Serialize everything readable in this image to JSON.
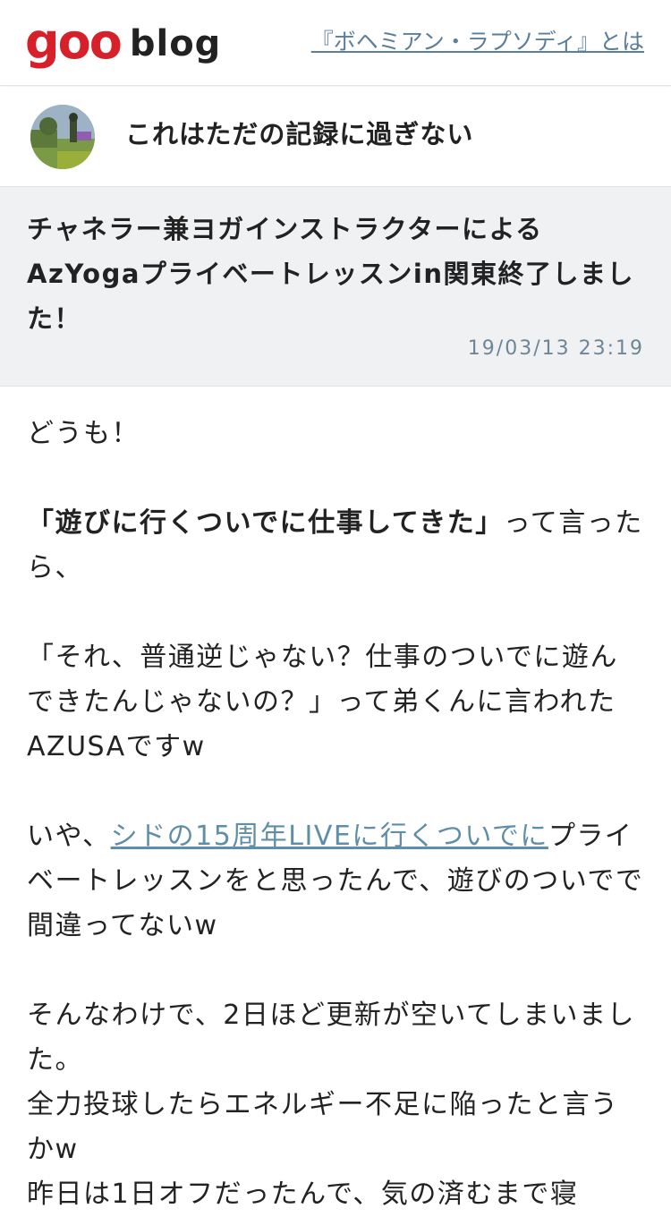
{
  "header": {
    "logo_goo": "goo",
    "logo_blog": "blog",
    "link_text": "『ボヘミアン・ラプソディ』とは"
  },
  "blog": {
    "title": "これはただの記録に過ぎない"
  },
  "article": {
    "title": "チャネラー兼ヨガインストラクターによるAzYogaプライベートレッスンin関東終了しました！",
    "date": "19/03/13 23:19",
    "paragraphs": {
      "p1": "どうも！",
      "p2_bold": "「遊びに行くついでに仕事してきた」",
      "p2_rest": "って言ったら、",
      "p3": "「それ、普通逆じゃない？仕事のついでに遊んできたんじゃないの？」って弟くんに言われたAZUSAですw",
      "p4_pre": "いや、",
      "p4_link": "シドの15周年LIVEに行くついでに",
      "p4_post": "プライベートレッスンをと思ったんで、遊びのついでで間違ってないw",
      "p5_line1": "そんなわけで、2日ほど更新が空いてしまいました。",
      "p5_line2": "全力投球したらエネルギー不足に陥ったと言うかw",
      "p5_line3": "昨日は1日オフだったんで、気の済むまで寝"
    }
  },
  "colors": {
    "brand_red": "#d6202a",
    "link": "#5f8ea9",
    "date": "#6d8697",
    "article_head_bg": "#f0f1f3"
  }
}
